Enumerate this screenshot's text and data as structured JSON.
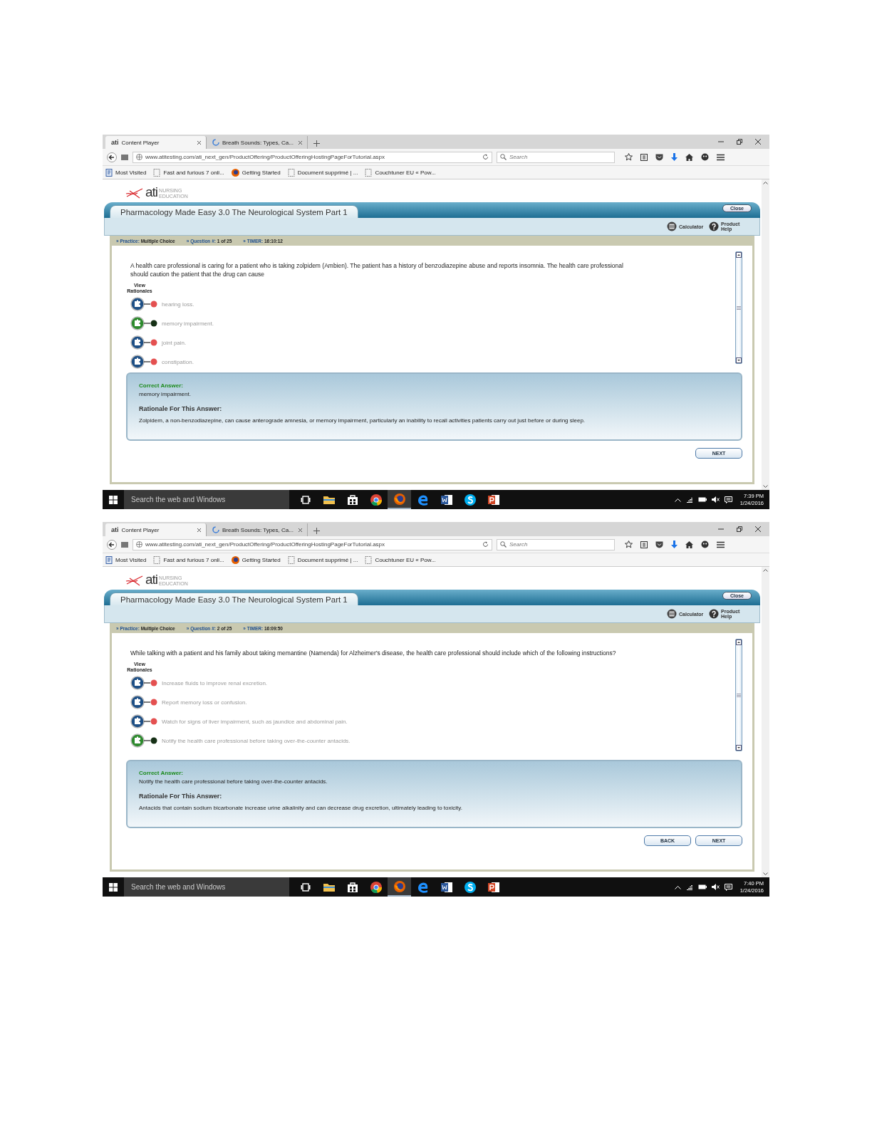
{
  "screens": [
    {
      "browser": {
        "tabs": [
          {
            "label": "Content Player",
            "favicon": "ati",
            "selected": true
          },
          {
            "label": "Breath Sounds: Types, Ca...",
            "selected": false
          }
        ],
        "url": "www.atitesting.com/ati_next_gen/ProductOffering/ProductOfferingHostingPageForTutorial.aspx",
        "search": {
          "placeholder": "Search"
        },
        "bookmarks": [
          {
            "kind": "folder",
            "label": "Most Visited"
          },
          {
            "kind": "page",
            "label": "Fast and furious 7 onli..."
          },
          {
            "kind": "firefox",
            "label": "Getting Started"
          },
          {
            "kind": "page",
            "label": "Document supprimé | ..."
          },
          {
            "kind": "page",
            "label": "Couchtuner EU « Pow..."
          }
        ]
      },
      "logo": {
        "text": "ati",
        "subtitle": "NURSING EDUCATION"
      },
      "player": {
        "title": "Pharmacology Made Easy 3.0 The Neurological System Part 1",
        "close": "Close",
        "tools": [
          {
            "kind": "calculator",
            "label": "Calculator"
          },
          {
            "kind": "help",
            "label": "Product Help"
          }
        ],
        "info": [
          {
            "label": "» Practice:",
            "value": "Multiple Choice"
          },
          {
            "label": "» Question #:",
            "value": "1 of 25"
          },
          {
            "label": "» TIMER:",
            "value": "16:10:12"
          }
        ],
        "question": "A health care professional is caring for a patient who is taking zolpidem (Ambien). The patient has a history of benzodiazepine abuse and reports insomnia. The health care professional should caution the patient that the drug can cause",
        "view_rationales": "View Rationales",
        "options": [
          {
            "text": "hearing loss.",
            "correct": false
          },
          {
            "text": "memory impairment.",
            "correct": true
          },
          {
            "text": "joint pain.",
            "correct": false
          },
          {
            "text": "constipation.",
            "correct": false
          }
        ],
        "answer": {
          "correct_label": "Correct Answer:",
          "correct_text": "memory impairment.",
          "rationale_label": "Rationale For This Answer:",
          "rationale_text": "Zolpidem, a non-benzodiazepine, can cause anterograde amnesia, or memory impairment, particularly an inability to recall activities patients carry out just before or during sleep."
        },
        "buttons": [
          "NEXT"
        ]
      },
      "taskbar": {
        "search_placeholder": "Search the web and Windows",
        "apps": [
          {
            "kind": "taskview",
            "active": false
          },
          {
            "kind": "explorer",
            "active": false
          },
          {
            "kind": "store",
            "active": false
          },
          {
            "kind": "chrome",
            "active": false
          },
          {
            "kind": "firefox",
            "active": true
          },
          {
            "kind": "edge",
            "active": false
          },
          {
            "kind": "word",
            "active": false
          },
          {
            "kind": "skype",
            "active": false
          },
          {
            "kind": "powerpoint",
            "active": false
          }
        ],
        "time": "7:39 PM",
        "date": "1/24/2016"
      }
    },
    {
      "browser": {
        "tabs": [
          {
            "label": "Content Player",
            "favicon": "ati",
            "selected": true
          },
          {
            "label": "Breath Sounds: Types, Ca...",
            "selected": false
          }
        ],
        "url": "www.atitesting.com/ati_next_gen/ProductOffering/ProductOfferingHostingPageForTutorial.aspx",
        "search": {
          "placeholder": "Search"
        },
        "bookmarks": [
          {
            "kind": "folder",
            "label": "Most Visited"
          },
          {
            "kind": "page",
            "label": "Fast and furious 7 onli..."
          },
          {
            "kind": "firefox",
            "label": "Getting Started"
          },
          {
            "kind": "page",
            "label": "Document supprimé | ..."
          },
          {
            "kind": "page",
            "label": "Couchtuner EU « Pow..."
          }
        ]
      },
      "logo": {
        "text": "ati",
        "subtitle": "NURSING EDUCATION"
      },
      "player": {
        "title": "Pharmacology Made Easy 3.0 The Neurological System Part 1",
        "close": "Close",
        "tools": [
          {
            "kind": "calculator",
            "label": "Calculator"
          },
          {
            "kind": "help",
            "label": "Product Help"
          }
        ],
        "info": [
          {
            "label": "» Practice:",
            "value": "Multiple Choice"
          },
          {
            "label": "» Question #:",
            "value": "2 of 25"
          },
          {
            "label": "» TIMER:",
            "value": "16:09:50"
          }
        ],
        "question": "While talking with a patient and his family about taking memantine (Namenda) for Alzheimer's disease, the health care professional should include which of the following instructions?",
        "view_rationales": "View Rationales",
        "options": [
          {
            "text": "Increase fluids to improve renal excretion.",
            "correct": false
          },
          {
            "text": "Report memory loss or confusion.",
            "correct": false
          },
          {
            "text": "Watch for signs of liver impairment, such as jaundice and abdominal pain.",
            "correct": false
          },
          {
            "text": "Notify the health care professional before taking over-the-counter antacids.",
            "correct": true
          }
        ],
        "answer": {
          "correct_label": "Correct Answer:",
          "correct_text": "Notify the health care professional before taking over-the-counter antacids.",
          "rationale_label": "Rationale For This Answer:",
          "rationale_text": "Antacids that contain sodium bicarbonate increase urine alkalinity and can decrease drug excretion, ultimately leading to toxicity."
        },
        "buttons": [
          "BACK",
          "NEXT"
        ]
      },
      "taskbar": {
        "search_placeholder": "Search the web and Windows",
        "apps": [
          {
            "kind": "taskview",
            "active": false
          },
          {
            "kind": "explorer",
            "active": false
          },
          {
            "kind": "store",
            "active": false
          },
          {
            "kind": "chrome",
            "active": false
          },
          {
            "kind": "firefox",
            "active": true
          },
          {
            "kind": "edge",
            "active": false
          },
          {
            "kind": "word",
            "active": false
          },
          {
            "kind": "skype",
            "active": false
          },
          {
            "kind": "powerpoint",
            "active": false
          }
        ],
        "time": "7:40 PM",
        "date": "1/24/2016"
      }
    }
  ]
}
